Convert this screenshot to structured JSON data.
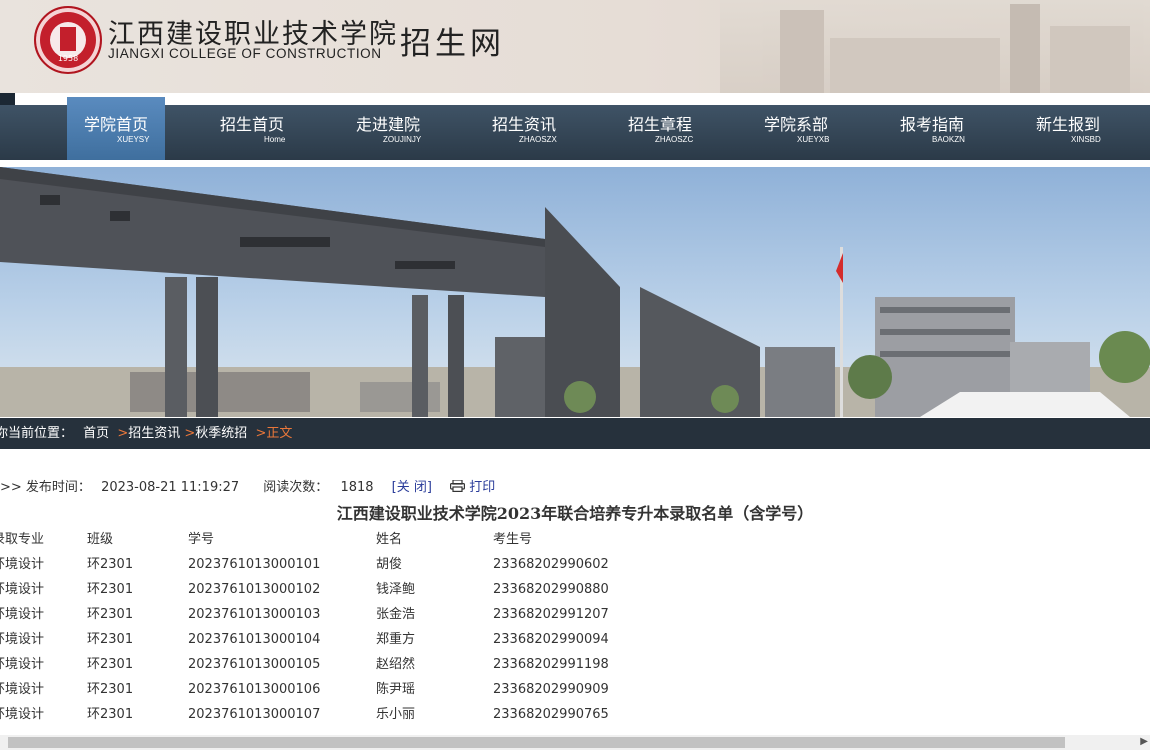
{
  "header": {
    "logo_year": "1958",
    "college_name_cn": "江西建设职业技术学院",
    "college_name_en": "JIANGXI COLLEGE OF CONSTRUCTION",
    "site_name": "招生网"
  },
  "nav": {
    "items": [
      {
        "label": "学院首页",
        "sub": "XUEYSY"
      },
      {
        "label": "招生首页",
        "sub": "Home"
      },
      {
        "label": "走进建院",
        "sub": "ZOUJINJY"
      },
      {
        "label": "招生资讯",
        "sub": "ZHAOSZX"
      },
      {
        "label": "招生章程",
        "sub": "ZHAOSZC"
      },
      {
        "label": "学院系部",
        "sub": "XUEYXB"
      },
      {
        "label": "报考指南",
        "sub": "BAOKZN"
      },
      {
        "label": "新生报到",
        "sub": "XINSBD"
      }
    ]
  },
  "breadcrumb": {
    "prefix": "你当前位置：",
    "items": [
      "首页",
      "招生资讯",
      "秋季统招",
      "正文"
    ],
    "sep": ">"
  },
  "article": {
    "meta_prefix": ">> 发布时间：",
    "publish_time": "2023-08-21 11:19:27",
    "reads_label": "阅读次数：",
    "reads": "1818",
    "close_label": "[关 闭]",
    "print_label": "打印",
    "title": "江西建设职业技术学院2023年联合培养专升本录取名单（含学号）"
  },
  "table": {
    "headers": [
      "录取专业",
      "班级",
      "学号",
      "姓名",
      "考生号"
    ],
    "rows": [
      [
        "环境设计",
        "环2301",
        "2023761013000101",
        "胡俊",
        "23368202990602"
      ],
      [
        "环境设计",
        "环2301",
        "2023761013000102",
        "钱泽鲍",
        "23368202990880"
      ],
      [
        "环境设计",
        "环2301",
        "2023761013000103",
        "张金浩",
        "23368202991207"
      ],
      [
        "环境设计",
        "环2301",
        "2023761013000104",
        "郑重方",
        "23368202990094"
      ],
      [
        "环境设计",
        "环2301",
        "2023761013000105",
        "赵绍然",
        "23368202991198"
      ],
      [
        "环境设计",
        "环2301",
        "2023761013000106",
        "陈尹瑶",
        "23368202990909"
      ],
      [
        "环境设计",
        "环2301",
        "2023761013000107",
        "乐小丽",
        "23368202990765"
      ]
    ]
  },
  "colors": {
    "nav_bg": "#2b3a48",
    "nav_active": "#4a7bad",
    "breadcrumb_bg": "#26313c",
    "accent_orange": "#e9773a",
    "link_blue": "#2a3c9a"
  }
}
